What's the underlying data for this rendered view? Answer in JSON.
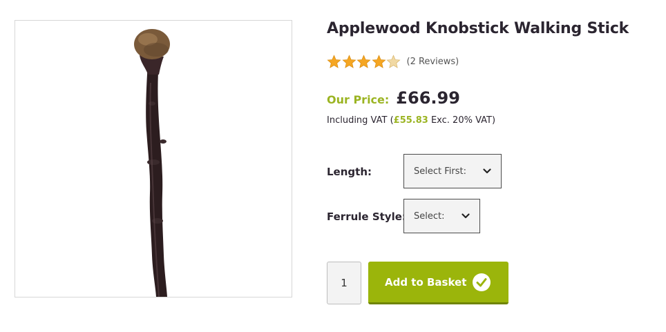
{
  "product": {
    "title": "Applewood Knobstick Walking Stick",
    "rating": {
      "value": 4.5,
      "max": 5,
      "reviews_label": "(2 Reviews)"
    },
    "price": {
      "label": "Our Price:",
      "value": "£66.99",
      "vat_prefix": "Including VAT (",
      "ex_value": "£55.83",
      "vat_suffix": " Exc. 20% VAT)"
    },
    "image_alt": "Applewood knobstick walking stick"
  },
  "options": {
    "length": {
      "label": "Length:",
      "selected": "Select First:"
    },
    "ferrule": {
      "label": "Ferrule Style:",
      "selected": "Select:"
    }
  },
  "cart": {
    "quantity": "1",
    "add_label": "Add to Basket"
  },
  "colors": {
    "accent_green": "#9bb422",
    "button_green": "#9bb50b",
    "star_gold": "#f5a623",
    "text_dark": "#2b2530"
  },
  "icons": {
    "dropdown": "chevron-down-icon",
    "add": "checkmark-circle-icon",
    "rating": "star-icon"
  }
}
